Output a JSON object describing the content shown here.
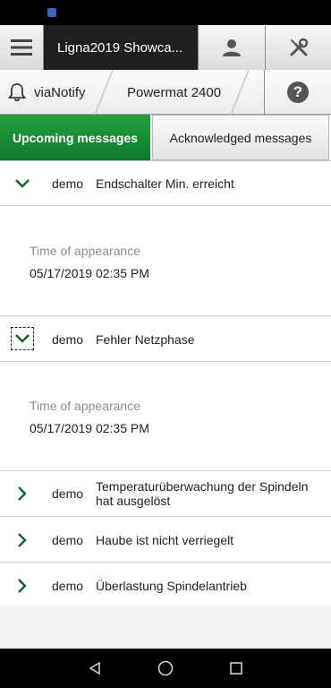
{
  "header": {
    "title": "Ligna2019 Showca...",
    "menu_icon": "hamburger-menu-icon",
    "user_icon": "user-icon",
    "tools_icon": "tools-icon"
  },
  "subheader": {
    "app_label": "viaNotify",
    "machine_label": "Powermat 2400",
    "help_icon": "help-icon"
  },
  "tabs": [
    {
      "label": "Upcoming messages",
      "active": true
    },
    {
      "label": "Acknowledged messages",
      "active": false
    }
  ],
  "messages": [
    {
      "source": "demo",
      "text": "Endschalter Min. erreicht",
      "expanded": true,
      "detail_label": "Time of appearance",
      "detail_value": "05/17/2019 02:35 PM"
    },
    {
      "source": "demo",
      "text": "Fehler Netzphase",
      "expanded": true,
      "detail_label": "Time of appearance",
      "detail_value": "05/17/2019 02:35 PM"
    },
    {
      "source": "demo",
      "text": "Temperaturüberwachung der Spindeln hat ausgelöst",
      "expanded": false
    },
    {
      "source": "demo",
      "text": "Haube ist nicht verriegelt",
      "expanded": false
    },
    {
      "source": "demo",
      "text": "Überlastung Spindelantrieb",
      "expanded": false
    }
  ],
  "colors": {
    "accent_green": "#128a30",
    "chevron_green": "#14602a"
  }
}
